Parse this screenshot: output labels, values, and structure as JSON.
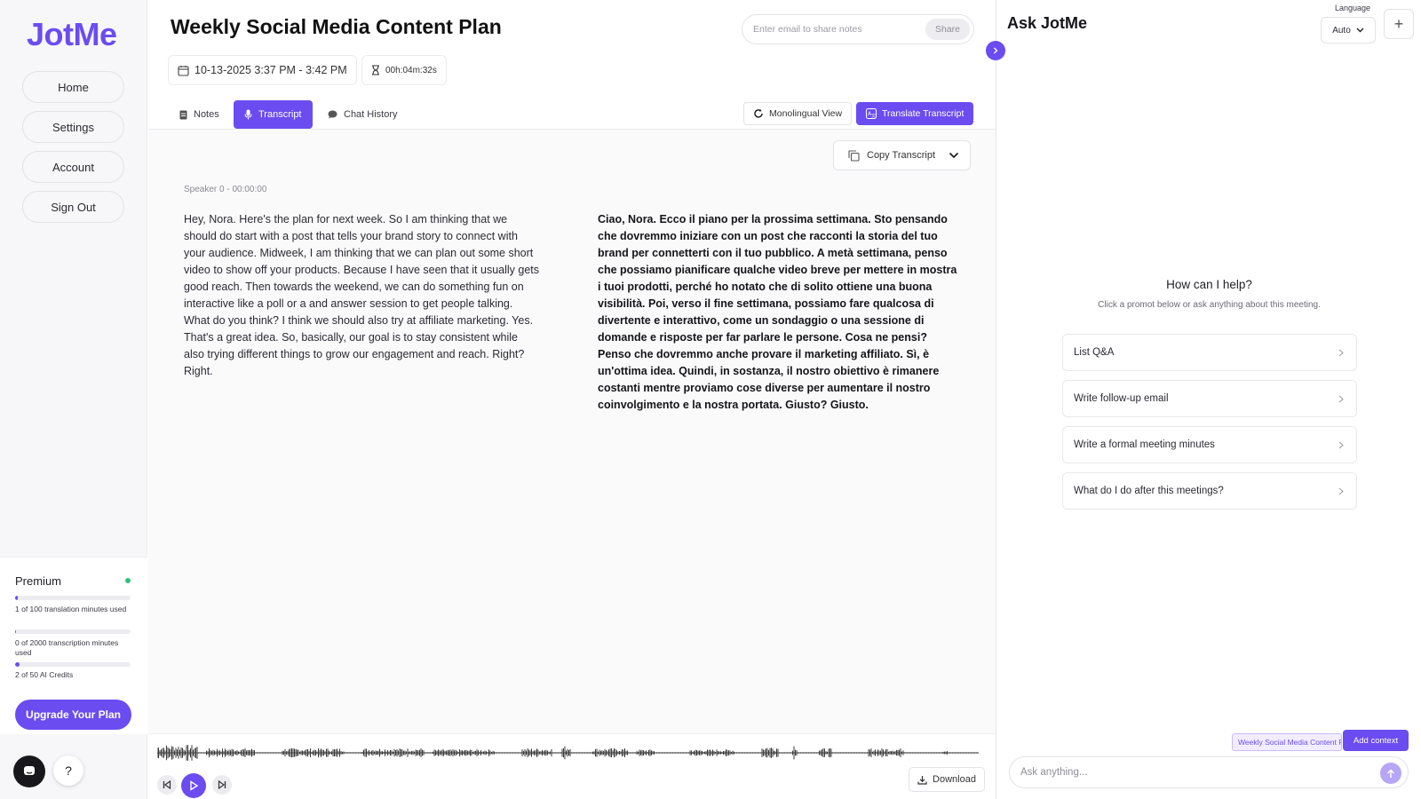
{
  "app": {
    "logo": "JotMe"
  },
  "sidebar": {
    "items": [
      {
        "label": "Home"
      },
      {
        "label": "Settings"
      },
      {
        "label": "Account"
      },
      {
        "label": "Sign Out"
      }
    ],
    "plan": {
      "name": "Premium",
      "usage": [
        {
          "text": "1 of 100 translation minutes used",
          "fraction": 0.01
        },
        {
          "text": "0 of 2000 transcription minutes used",
          "fraction": 0.0
        },
        {
          "text": "2 of 50 AI Credits",
          "fraction": 0.04
        }
      ],
      "upgrade_label": "Upgrade Your Plan"
    },
    "help_label": "?"
  },
  "main": {
    "title": "Weekly Social Media Content Plan",
    "share": {
      "placeholder": "Enter email to share notes",
      "button_label": "Share"
    },
    "date_range": "10-13-2025 3:37 PM - 3:42 PM",
    "duration": "00h:04m:32s",
    "tabs": [
      {
        "label": "Notes",
        "active": false
      },
      {
        "label": "Transcript",
        "active": true
      },
      {
        "label": "Chat History",
        "active": false
      }
    ],
    "view_buttons": {
      "monolingual": "Monolingual View",
      "translate": "Translate Transcript"
    },
    "copy_label": "Copy Transcript",
    "speaker": "Speaker 0 - 00:00:00",
    "transcript_original": "Hey, Nora. Here's the plan for next week. So I am thinking that we should do start with a post that tells your brand story to connect with your audience. Midweek, I am thinking that we can plan out some short video to show off your products. Because I have seen that it usually gets good reach. Then towards the weekend, we can do something fun on interactive like a poll or a and answer session to get people talking. What do you think? I think we should also try at affiliate marketing. Yes. That's a great idea. So, basically, our goal is to stay consistent while also trying different things to grow our engagement and reach. Right? Right.",
    "transcript_translated": "Ciao, Nora. Ecco il piano per la prossima settimana. Sto pensando che dovremmo iniziare con un post che racconti la storia del tuo brand per connetterti con il tuo pubblico. A metà settimana, penso che possiamo pianificare qualche video breve per mettere in mostra i tuoi prodotti, perché ho notato che di solito ottiene una buona visibilità. Poi, verso il fine settimana, possiamo fare qualcosa di divertente e interattivo, come un sondaggio o una sessione di domande e risposte per far parlare le persone. Cosa ne pensi? Penso che dovremmo anche provare il marketing affiliato. Sì, è un'ottima idea. Quindi, in sostanza, il nostro obiettivo è rimanere costanti mentre proviamo cose diverse per aumentare il nostro coinvolgimento e la nostra portata. Giusto? Giusto.",
    "player": {
      "download_label": "Download"
    }
  },
  "panel": {
    "title": "Ask JotMe",
    "language_label": "Language",
    "language_value": "Auto",
    "new_label": "+",
    "help_title": "How can I help?",
    "help_subtitle": "Click a promot below or ask anything about this meeting.",
    "prompts": [
      {
        "label": "List Q&A"
      },
      {
        "label": "Write follow-up email"
      },
      {
        "label": "Write a formal meeting minutes"
      },
      {
        "label": "What do I do after this meetings?"
      }
    ],
    "context_chip": "Weekly Social Media Content Plan",
    "add_context_label": "Add context",
    "ask_placeholder": "Ask anything..."
  },
  "colors": {
    "accent": "#6b4cf0",
    "status_active": "#2ec27e"
  }
}
